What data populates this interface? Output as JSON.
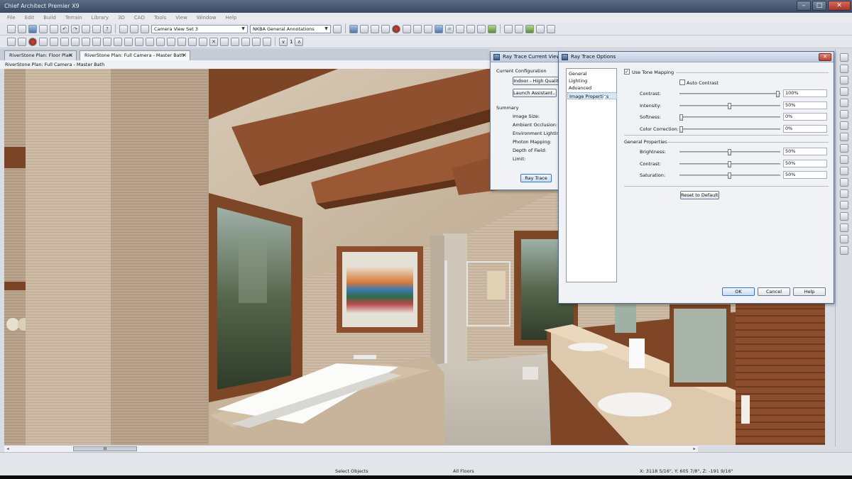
{
  "window": {
    "title": "Chief Architect Premier X9"
  },
  "menu": [
    "File",
    "Edit",
    "Build",
    "Terrain",
    "Library",
    "3D",
    "CAD",
    "Tools",
    "View",
    "Window",
    "Help"
  ],
  "toolbar": {
    "camera_view_set": "Camera View Set 3",
    "annotation_set": "NKBA General Annotations",
    "counter": "1"
  },
  "tabs": [
    {
      "label": "RiverStone Plan: Floor Plan",
      "active": false
    },
    {
      "label": "RiverStone Plan: Full Camera - Master Bath",
      "active": true
    }
  ],
  "view_path": "RiverStone Plan: Full Camera - Master Bath",
  "ray_trace_view": {
    "title": "Ray Trace Current View",
    "current_configuration_label": "Current Configuration",
    "configuration": "Indoor - High Quality",
    "launch_assistant": "Launch Assistant...",
    "summary_label": "Summary",
    "summary_items": [
      "Image Size:",
      "Ambient Occlusion:",
      "Environment Lighting:",
      "Photon Mapping:",
      "Depth of Field:",
      "Limit:"
    ],
    "ray_trace_button": "Ray Trace"
  },
  "ray_trace_options": {
    "title": "Ray Trace Options",
    "nav": [
      "General",
      "Lighting",
      "Advanced",
      "Image Properties"
    ],
    "selected_nav": "Image Properties",
    "use_tone_mapping": {
      "label": "Use Tone Mapping",
      "checked": true
    },
    "auto_contrast": {
      "label": "Auto Contrast",
      "checked": false
    },
    "tone_sliders": [
      {
        "label": "Contrast:",
        "value": "100%",
        "level": 1.0
      },
      {
        "label": "Intensity:",
        "value": "50%",
        "level": 0.5
      },
      {
        "label": "Softness:",
        "value": "0%",
        "level": 0.0
      },
      {
        "label": "Color Correction:",
        "value": "0%",
        "level": 0.0
      }
    ],
    "general_properties_label": "General Properties",
    "general_sliders": [
      {
        "label": "Brightness:",
        "value": "50%",
        "level": 0.5
      },
      {
        "label": "Contrast:",
        "value": "50%",
        "level": 0.5
      },
      {
        "label": "Saturation:",
        "value": "50%",
        "level": 0.5
      }
    ],
    "reset_button": "Reset to Defaults",
    "ok_button": "OK",
    "cancel_button": "Cancel",
    "help_button": "Help"
  },
  "status": {
    "mode": "Select Objects",
    "floor": "All Floors",
    "coords": "X: 3118 5/16\", Y: 605 7/8\", Z: -191 9/16\""
  },
  "scroll_arrow": "III"
}
